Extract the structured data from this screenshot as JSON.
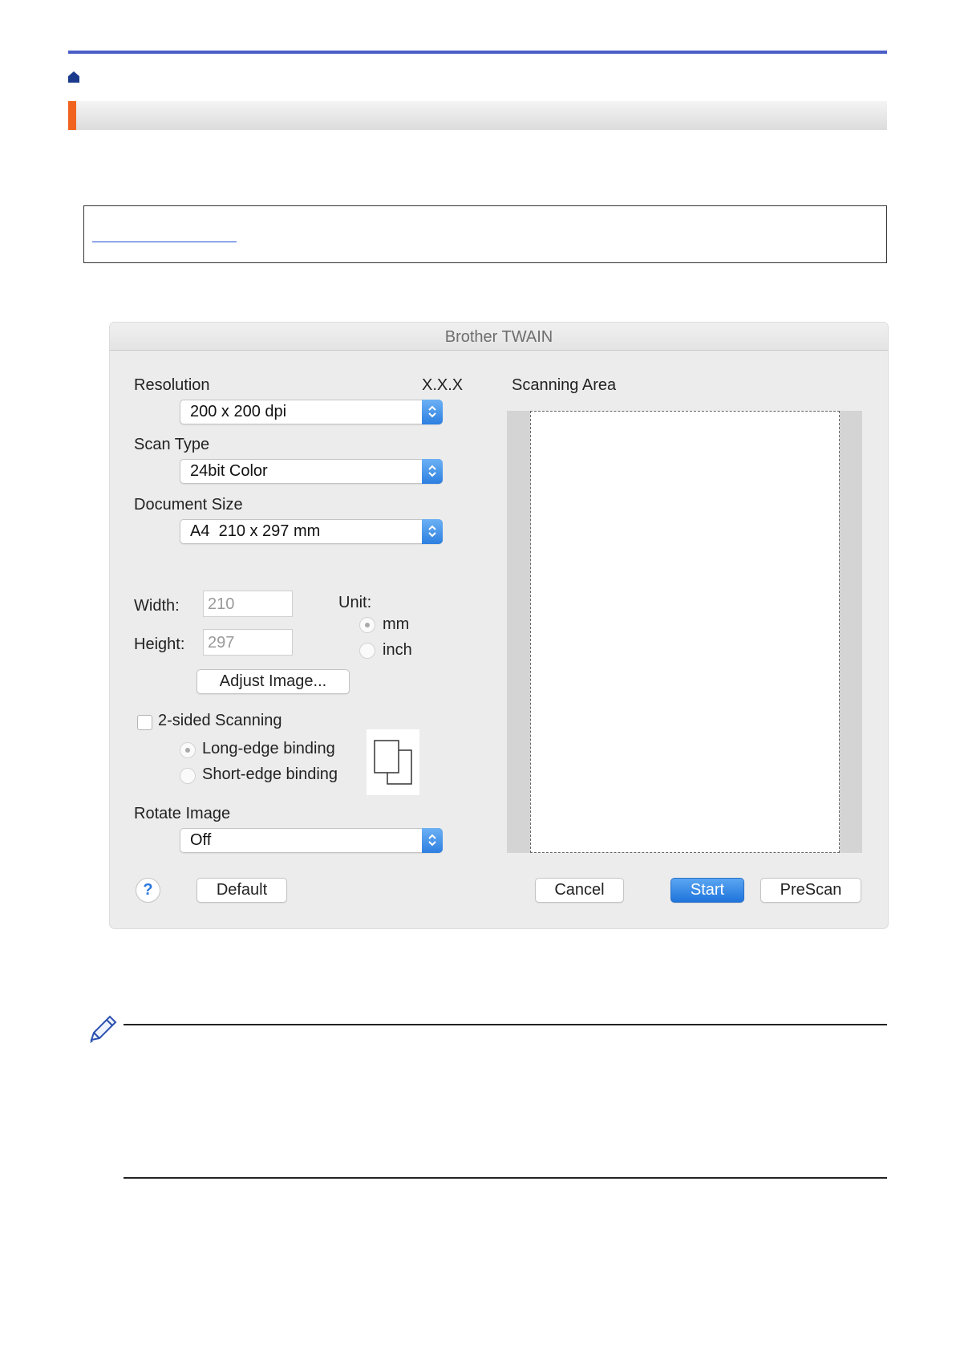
{
  "breadcrumb": {
    "home_icon": "home-icon"
  },
  "heading": {
    "text": ""
  },
  "dialog": {
    "title": "Brother TWAIN",
    "version": "X.X.X",
    "resolution": {
      "label": "Resolution",
      "value": "200 x 200 dpi"
    },
    "scan_type": {
      "label": "Scan Type",
      "value": "24bit Color"
    },
    "document_size": {
      "label": "Document Size",
      "value": "A4  210 x 297 mm"
    },
    "width": {
      "label": "Width:",
      "value": "210"
    },
    "height": {
      "label": "Height:",
      "value": "297"
    },
    "unit": {
      "label": "Unit:",
      "options": [
        "mm",
        "inch"
      ],
      "selected": "mm"
    },
    "adjust_image_label": "Adjust Image...",
    "two_sided": {
      "label": "2-sided Scanning",
      "checked": false,
      "options": [
        "Long-edge binding",
        "Short-edge binding"
      ],
      "selected": "Long-edge binding"
    },
    "rotate_image": {
      "label": "Rotate Image",
      "value": "Off"
    },
    "scanning_area_label": "Scanning Area",
    "buttons": {
      "help": "?",
      "default": "Default",
      "cancel": "Cancel",
      "start": "Start",
      "prescan": "PreScan"
    }
  },
  "colors": {
    "accent_bar": "#f06420",
    "top_rule": "#4a5ec7",
    "primary_button": "#1f74db",
    "link": "#1a4fd0"
  },
  "note": {
    "icon": "pencil-icon"
  }
}
